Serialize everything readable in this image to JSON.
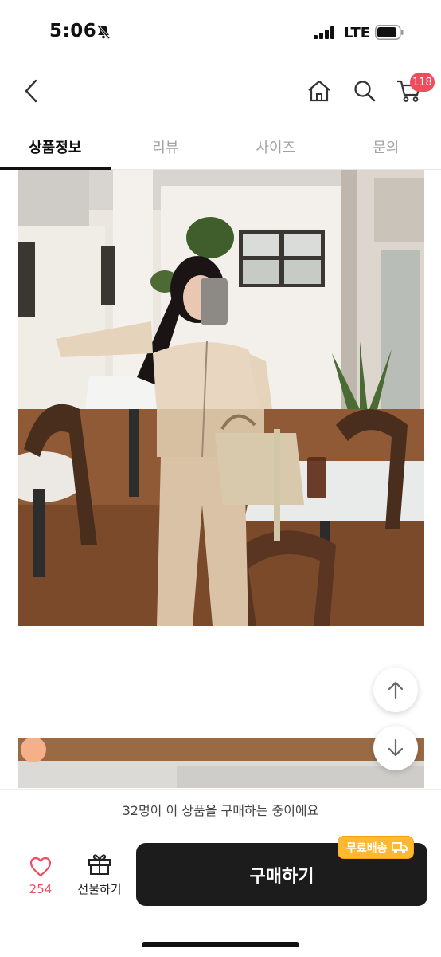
{
  "status_bar": {
    "time": "5:06",
    "network": "LTE",
    "icons": [
      "bell-slash-icon",
      "signal-icon",
      "battery-icon"
    ]
  },
  "nav": {
    "icons": [
      "back-icon",
      "home-icon",
      "search-icon",
      "cart-icon"
    ],
    "cart_count": "118"
  },
  "tabs": [
    {
      "label": "상품정보",
      "active": true
    },
    {
      "label": "리뷰",
      "active": false
    },
    {
      "label": "사이즈",
      "active": false
    },
    {
      "label": "문의",
      "active": false
    }
  ],
  "product_images": [
    "product-photo-main",
    "product-photo-second"
  ],
  "scroll": {
    "up_icon": "arrow-up-icon",
    "down_icon": "arrow-down-icon"
  },
  "buyers_text": "32명이 이 상품을 구매하는 중이에요",
  "bottom": {
    "like_icon": "heart-icon",
    "like_count": "254",
    "gift_icon": "gift-icon",
    "gift_label": "선물하기",
    "buy_label": "구매하기",
    "free_shipping": "무료배송",
    "shipping_icon": "truck-icon"
  },
  "colors": {
    "accent": "#f14b5e",
    "buy_button": "#1c1c1c",
    "shipping_badge": "#ffb930",
    "tab_inactive": "#a3a3a3"
  }
}
